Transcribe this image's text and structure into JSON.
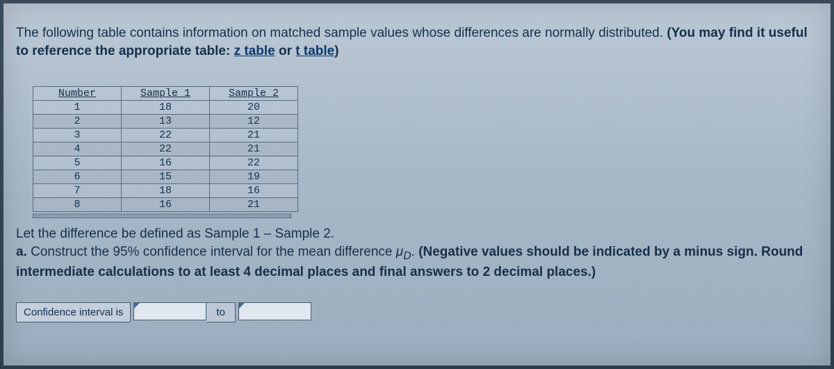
{
  "intro": {
    "line1": "The following table contains information on matched sample values whose differences are normally distributed. ",
    "bold_open": "(You may find it useful to reference the appropriate table: ",
    "link1": "z table",
    "or": " or ",
    "link2": "t table",
    "bold_close": ")"
  },
  "table": {
    "headers": [
      "Number",
      "Sample 1",
      "Sample 2"
    ],
    "rows": [
      {
        "n": "1",
        "s1": "18",
        "s2": "20",
        "even": false
      },
      {
        "n": "2",
        "s1": "13",
        "s2": "12",
        "even": true
      },
      {
        "n": "3",
        "s1": "22",
        "s2": "21",
        "even": false
      },
      {
        "n": "4",
        "s1": "22",
        "s2": "21",
        "even": true
      },
      {
        "n": "5",
        "s1": "16",
        "s2": "22",
        "even": false
      },
      {
        "n": "6",
        "s1": "15",
        "s2": "19",
        "even": true
      },
      {
        "n": "7",
        "s1": "18",
        "s2": "16",
        "even": false
      },
      {
        "n": "8",
        "s1": "16",
        "s2": "21",
        "even": true
      }
    ]
  },
  "question": {
    "diff_line": "Let the difference be defined as Sample 1 – Sample 2.",
    "part_label": "a.",
    "part_text1": " Construct the 95% confidence interval for the mean difference ",
    "mu": "μ",
    "mu_sub": "D",
    "part_text2": ". ",
    "bold_hint": "(Negative values should be indicated by a minus sign. Round intermediate calculations to at least 4 decimal places and final answers to 2 decimal places.)"
  },
  "answer": {
    "label": "Confidence interval is",
    "to": "to"
  },
  "chart_data": {
    "type": "table",
    "title": "Matched sample values",
    "columns": [
      "Number",
      "Sample 1",
      "Sample 2"
    ],
    "rows": [
      [
        1,
        18,
        20
      ],
      [
        2,
        13,
        12
      ],
      [
        3,
        22,
        21
      ],
      [
        4,
        22,
        21
      ],
      [
        5,
        16,
        22
      ],
      [
        6,
        15,
        19
      ],
      [
        7,
        18,
        16
      ],
      [
        8,
        16,
        21
      ]
    ]
  }
}
